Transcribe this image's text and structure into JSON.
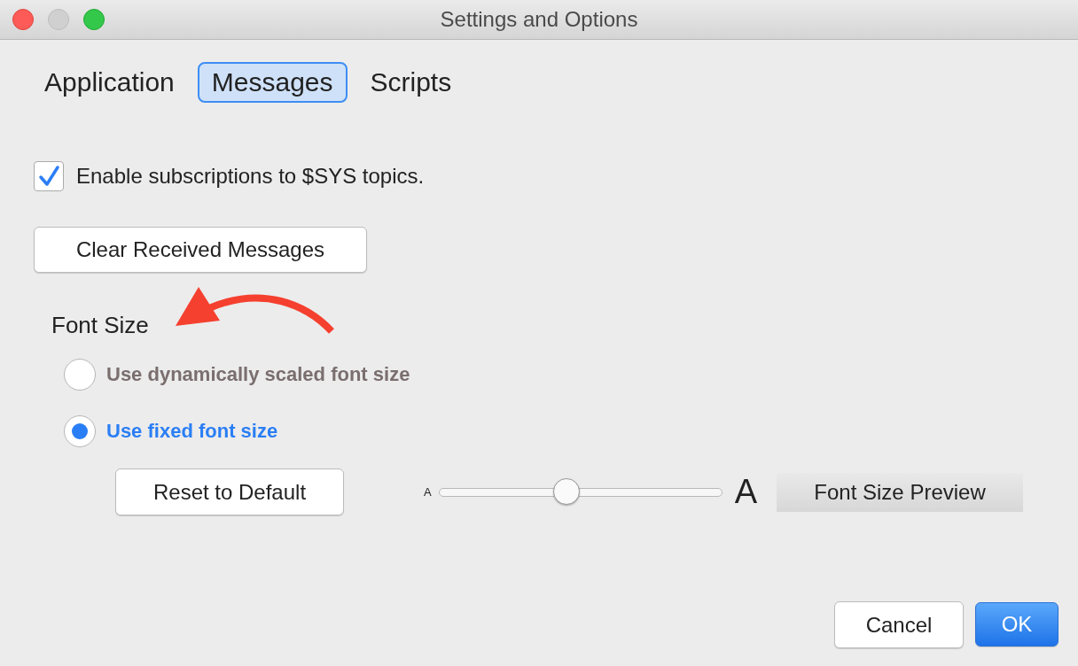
{
  "window": {
    "title": "Settings and Options"
  },
  "tabs": [
    {
      "label": "Application",
      "selected": false
    },
    {
      "label": "Messages",
      "selected": true
    },
    {
      "label": "Scripts",
      "selected": false
    }
  ],
  "subscriptions_checkbox": {
    "label": "Enable subscriptions to $SYS topics.",
    "checked": true
  },
  "clear_button": {
    "label": "Clear Received Messages"
  },
  "font_size": {
    "heading": "Font Size",
    "options": [
      {
        "label": "Use dynamically scaled font size",
        "selected": false
      },
      {
        "label": "Use fixed font size",
        "selected": true
      }
    ],
    "reset_button": {
      "label": "Reset to Default"
    },
    "slider": {
      "min_label": "A",
      "max_label": "A",
      "level": 0.45
    },
    "preview": {
      "label": "Font Size Preview"
    }
  },
  "buttons": [
    {
      "label": "Cancel",
      "kind": "default"
    },
    {
      "label": "OK",
      "kind": "primary"
    }
  ]
}
